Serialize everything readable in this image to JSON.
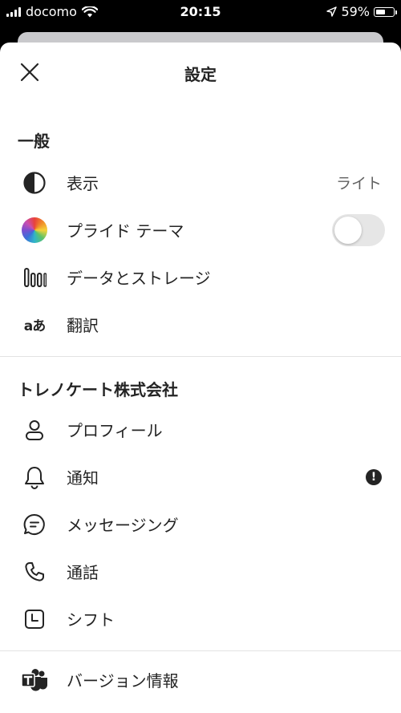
{
  "status_bar": {
    "carrier": "docomo",
    "time": "20:15",
    "battery": "59%",
    "battery_level": 0.59
  },
  "header": {
    "title": "設定"
  },
  "sections": {
    "general": {
      "title": "一般",
      "display_label": "表示",
      "display_value": "ライト",
      "pride_label": "プライド テーマ",
      "pride_enabled": false,
      "data_storage_label": "データとストレージ",
      "translation_label": "翻訳",
      "translation_icon_text": "aあ"
    },
    "org": {
      "title": "トレノケート株式会社",
      "profile_label": "プロフィール",
      "notifications_label": "通知",
      "notifications_alert": "!",
      "messaging_label": "メッセージング",
      "calls_label": "通話",
      "shifts_label": "シフト"
    },
    "about": {
      "version_label": "バージョン情報"
    }
  },
  "colors": {
    "text": "#242424",
    "secondary_text": "#616161",
    "toggle_off": "#e6e6e6"
  },
  "icons": [
    "close-icon",
    "display-mode-icon",
    "pride-theme-icon",
    "data-storage-icon",
    "translation-icon",
    "profile-icon",
    "bell-icon",
    "chat-icon",
    "phone-icon",
    "calendar-icon",
    "teams-logo-icon"
  ]
}
